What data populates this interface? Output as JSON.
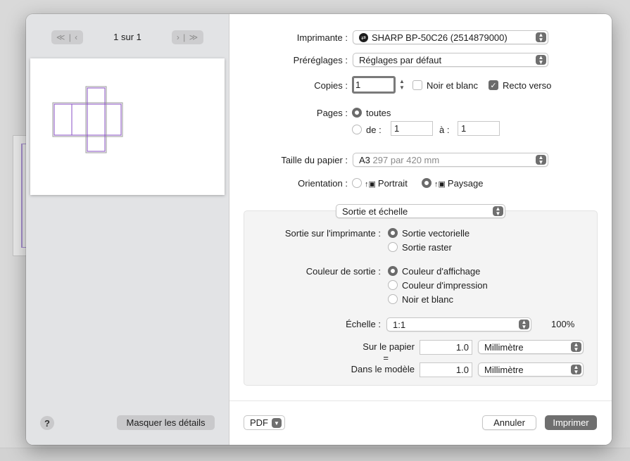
{
  "nav": {
    "first_prev": "≪ | ‹",
    "next_last": "› | ≫",
    "page_count": "1 sur 1"
  },
  "left_footer": {
    "help_label": "?",
    "hide_details_label": "Masquer les détails"
  },
  "printer": {
    "label": "Imprimante :",
    "value": "SHARP BP-50C26 (2514879000)"
  },
  "presets": {
    "label": "Préréglages :",
    "value": "Réglages par défaut"
  },
  "copies": {
    "label": "Copies :",
    "value": "1",
    "bw_label": "Noir et blanc",
    "bw_checked": false,
    "duplex_label": "Recto verso",
    "duplex_checked": true
  },
  "pages": {
    "label": "Pages :",
    "all_label": "toutes",
    "all_selected": true,
    "from_label": "de :",
    "from_value": "1",
    "to_label": "à :",
    "to_value": "1"
  },
  "paper_size": {
    "label": "Taille du papier :",
    "value": "A3",
    "detail": "297 par 420 mm"
  },
  "orientation": {
    "label": "Orientation :",
    "portrait_label": "Portrait",
    "landscape_label": "Paysage",
    "selected": "Paysage"
  },
  "section_popup": {
    "value": "Sortie et échelle"
  },
  "output": {
    "label": "Sortie sur l'imprimante :",
    "options": [
      "Sortie vectorielle",
      "Sortie raster"
    ],
    "selected": "Sortie vectorielle"
  },
  "color": {
    "label": "Couleur de sortie :",
    "options": [
      "Couleur d'affichage",
      "Couleur d'impression",
      "Noir et blanc"
    ],
    "selected": "Couleur d'affichage"
  },
  "scale": {
    "label": "Échelle :",
    "value": "1:1",
    "percent": "100%",
    "paper_label": "Sur le papier",
    "equals": "=",
    "model_label": "Dans le modèle",
    "paper_value": "1.0",
    "paper_unit": "Millimètre",
    "model_value": "1.0",
    "model_unit": "Millimètre"
  },
  "footer": {
    "pdf_label": "PDF",
    "cancel_label": "Annuler",
    "print_label": "Imprimer"
  },
  "colors": {
    "accent": "#6f6f6f",
    "sidebar": "#e2e3e5",
    "preview_lines": "#8a4fc4"
  },
  "icons": [
    "rewind-icon",
    "fast-forward-icon",
    "printer-icon",
    "stepper-icon",
    "chevron-down-icon",
    "portrait-icon",
    "landscape-icon",
    "checkmark-icon"
  ]
}
